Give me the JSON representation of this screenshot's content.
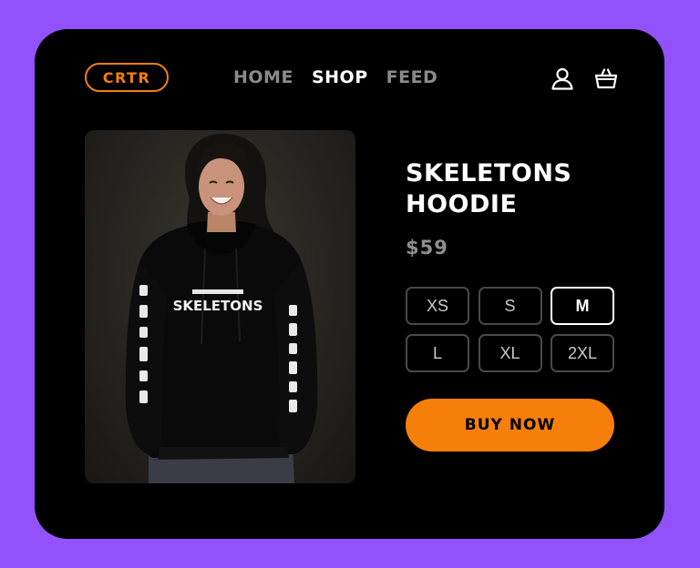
{
  "brand": {
    "logo_text": "CRTR",
    "accent_color": "#f57f0c"
  },
  "nav": {
    "items": [
      {
        "label": "HOME",
        "active": false
      },
      {
        "label": "SHOP",
        "active": true
      },
      {
        "label": "FEED",
        "active": false
      }
    ]
  },
  "header_icons": [
    "user-icon",
    "basket-icon"
  ],
  "product": {
    "title": "SKELETONS HOODIE",
    "price": "$59",
    "image_alt": "Person wearing a black hoodie with white print",
    "print_front": "SKELETONS",
    "sizes": [
      {
        "label": "XS",
        "selected": false
      },
      {
        "label": "S",
        "selected": false
      },
      {
        "label": "M",
        "selected": true
      },
      {
        "label": "L",
        "selected": false
      },
      {
        "label": "XL",
        "selected": false
      },
      {
        "label": "2XL",
        "selected": false
      }
    ],
    "buy_label": "BUY NOW"
  },
  "colors": {
    "page_background": "#9152fb",
    "card_background": "#000000",
    "button_accent": "#f67f0b",
    "muted_text": "#8e8e8e"
  }
}
